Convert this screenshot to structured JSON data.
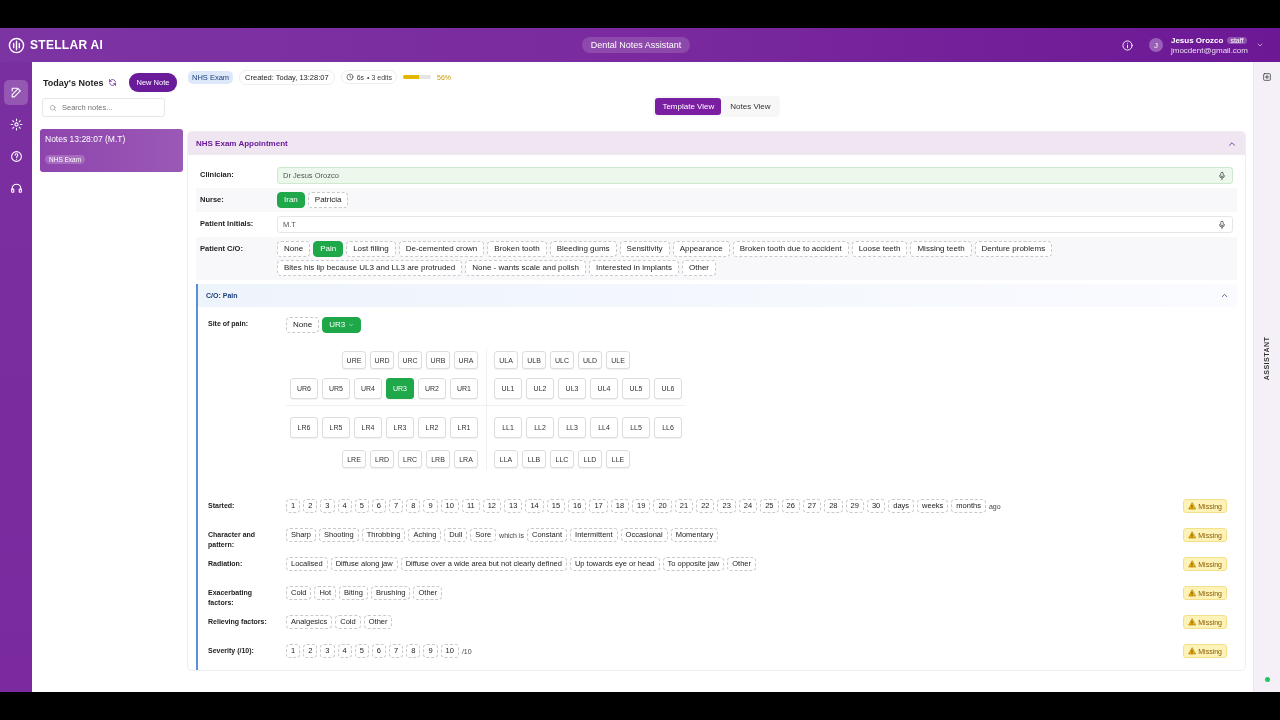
{
  "header": {
    "logo": "STELLAR AI",
    "app_title": "Dental Notes Assistant",
    "user": {
      "initial": "J",
      "name": "Jesus Orozco",
      "role": "staff",
      "email": "jmocdent@gmail.com"
    }
  },
  "rail": [
    {
      "selected": true
    },
    {
      "selected": false
    },
    {
      "selected": false
    },
    {
      "selected": false
    }
  ],
  "notes_panel": {
    "title": "Today's Notes",
    "new_button": "New Note",
    "search": {
      "placeholder": "Search notes..."
    },
    "notes": [
      {
        "title": "Notes 13:28:07 (M.T)",
        "tag": "NHS Exam",
        "selected": true
      }
    ]
  },
  "meta": {
    "template": "NHS Exam",
    "created": "Created: Today, 13:28:07",
    "timer": "6s",
    "edits": "• 3 edits",
    "progress": {
      "level": 0.56,
      "reading": "56%"
    }
  },
  "view_tabs": [
    {
      "label": "Template View",
      "selected": true
    },
    {
      "label": "Notes View",
      "selected": false
    }
  ],
  "section": {
    "title": "NHS Exam Appointment",
    "expanded": true,
    "fields": [
      {
        "kind": "text",
        "label": "Clinician:",
        "value": "Dr Jesus Orozco",
        "filled": true
      },
      {
        "kind": "chips",
        "label": "Nurse:",
        "options": [
          {
            "label": "Iran",
            "selected": true
          },
          {
            "label": "Patricia",
            "selected": false
          }
        ]
      },
      {
        "kind": "text",
        "label": "Patient Initials:",
        "value": "M.T",
        "filled": false
      },
      {
        "kind": "chips",
        "label": "Patient C/O:",
        "options": [
          {
            "label": "None",
            "selected": false
          },
          {
            "label": "Pain",
            "selected": true
          },
          {
            "label": "Lost filling",
            "selected": false
          },
          {
            "label": "De-cemented crown",
            "selected": false
          },
          {
            "label": "Broken tooth",
            "selected": false
          },
          {
            "label": "Bleeding gums",
            "selected": false
          },
          {
            "label": "Sensitivity",
            "selected": false
          },
          {
            "label": "Appearance",
            "selected": false
          },
          {
            "label": "Broken tooth due to accident",
            "selected": false
          },
          {
            "label": "Loose teeth",
            "selected": false
          },
          {
            "label": "Missing teeth",
            "selected": false
          },
          {
            "label": "Denture problems",
            "selected": false
          },
          {
            "label": "Bites his lip because UL3 and LL3 are protruded",
            "selected": false
          },
          {
            "label": "None - wants scale and polish",
            "selected": false
          },
          {
            "label": "Interested in implants",
            "selected": false
          },
          {
            "label": "Other",
            "selected": false
          }
        ]
      }
    ],
    "subsection": {
      "title": "C/O: Pain",
      "expanded": true,
      "site": {
        "label": "Site of pain:",
        "options": [
          {
            "label": "None",
            "selected": false
          },
          {
            "label": "UR3",
            "selected": true
          }
        ]
      },
      "teeth": [
        {
          "left": [
            {
              "label": "URE",
              "selected": false
            },
            {
              "label": "URD",
              "selected": false
            },
            {
              "label": "URC",
              "selected": false
            },
            {
              "label": "URB",
              "selected": false
            },
            {
              "label": "URA",
              "selected": false
            }
          ],
          "right": [
            {
              "label": "ULA",
              "selected": false
            },
            {
              "label": "ULB",
              "selected": false
            },
            {
              "label": "ULC",
              "selected": false
            },
            {
              "label": "ULD",
              "selected": false
            },
            {
              "label": "ULE",
              "selected": false
            }
          ]
        },
        {
          "left": [
            {
              "label": "UR6",
              "selected": false
            },
            {
              "label": "UR5",
              "selected": false
            },
            {
              "label": "UR4",
              "selected": false
            },
            {
              "label": "UR3",
              "selected": true
            },
            {
              "label": "UR2",
              "selected": false
            },
            {
              "label": "UR1",
              "selected": false
            }
          ],
          "right": [
            {
              "label": "UL1",
              "selected": false
            },
            {
              "label": "UL2",
              "selected": false
            },
            {
              "label": "UL3",
              "selected": false
            },
            {
              "label": "UL4",
              "selected": false
            },
            {
              "label": "UL5",
              "selected": false
            },
            {
              "label": "UL6",
              "selected": false
            }
          ]
        },
        {
          "left": [
            {
              "label": "LR6",
              "selected": false
            },
            {
              "label": "LR5",
              "selected": false
            },
            {
              "label": "LR4",
              "selected": false
            },
            {
              "label": "LR3",
              "selected": false
            },
            {
              "label": "LR2",
              "selected": false
            },
            {
              "label": "LR1",
              "selected": false
            }
          ],
          "right": [
            {
              "label": "LL1",
              "selected": false
            },
            {
              "label": "LL2",
              "selected": false
            },
            {
              "label": "LL3",
              "selected": false
            },
            {
              "label": "LL4",
              "selected": false
            },
            {
              "label": "LL5",
              "selected": false
            },
            {
              "label": "LL6",
              "selected": false
            }
          ]
        },
        {
          "left": [
            {
              "label": "LRE",
              "selected": false
            },
            {
              "label": "LRD",
              "selected": false
            },
            {
              "label": "LRC",
              "selected": false
            },
            {
              "label": "LRB",
              "selected": false
            },
            {
              "label": "LRA",
              "selected": false
            }
          ],
          "right": [
            {
              "label": "LLA",
              "selected": false
            },
            {
              "label": "LLB",
              "selected": false
            },
            {
              "label": "LLC",
              "selected": false
            },
            {
              "label": "LLD",
              "selected": false
            },
            {
              "label": "LLE",
              "selected": false
            }
          ]
        }
      ],
      "rows": [
        {
          "label": "Started:",
          "status": "Missing",
          "parts": [
            {
              "kind": "chips",
              "options": [
                {
                  "label": "1",
                  "selected": false
                },
                {
                  "label": "2",
                  "selected": false
                },
                {
                  "label": "3",
                  "selected": false
                },
                {
                  "label": "4",
                  "selected": false
                },
                {
                  "label": "5",
                  "selected": false
                },
                {
                  "label": "6",
                  "selected": false
                },
                {
                  "label": "7",
                  "selected": false
                },
                {
                  "label": "8",
                  "selected": false
                },
                {
                  "label": "9",
                  "selected": false
                },
                {
                  "label": "10",
                  "selected": false
                },
                {
                  "label": "11",
                  "selected": false
                },
                {
                  "label": "12",
                  "selected": false
                },
                {
                  "label": "13",
                  "selected": false
                },
                {
                  "label": "14",
                  "selected": false
                },
                {
                  "label": "15",
                  "selected": false
                },
                {
                  "label": "16",
                  "selected": false
                },
                {
                  "label": "17",
                  "selected": false
                },
                {
                  "label": "18",
                  "selected": false
                },
                {
                  "label": "19",
                  "selected": false
                },
                {
                  "label": "20",
                  "selected": false
                },
                {
                  "label": "21",
                  "selected": false
                },
                {
                  "label": "22",
                  "selected": false
                },
                {
                  "label": "23",
                  "selected": false
                },
                {
                  "label": "24",
                  "selected": false
                },
                {
                  "label": "25",
                  "selected": false
                },
                {
                  "label": "26",
                  "selected": false
                },
                {
                  "label": "27",
                  "selected": false
                },
                {
                  "label": "28",
                  "selected": false
                },
                {
                  "label": "29",
                  "selected": false
                },
                {
                  "label": "30",
                  "selected": false
                }
              ]
            },
            {
              "kind": "chips",
              "options": [
                {
                  "label": "days",
                  "selected": false
                },
                {
                  "label": "weeks",
                  "selected": false
                },
                {
                  "label": "months",
                  "selected": false
                }
              ]
            },
            {
              "kind": "text",
              "text": "ago"
            }
          ]
        },
        {
          "label": "Character and pattern:",
          "status": "Missing",
          "parts": [
            {
              "kind": "chips",
              "options": [
                {
                  "label": "Sharp",
                  "selected": false
                },
                {
                  "label": "Shooting",
                  "selected": false
                },
                {
                  "label": "Throbbing",
                  "selected": false
                },
                {
                  "label": "Aching",
                  "selected": false
                },
                {
                  "label": "Dull",
                  "selected": false
                },
                {
                  "label": "Sore",
                  "selected": false
                }
              ]
            },
            {
              "kind": "text",
              "text": "which is"
            },
            {
              "kind": "chips",
              "options": [
                {
                  "label": "Constant",
                  "selected": false
                },
                {
                  "label": "Intermittent",
                  "selected": false
                },
                {
                  "label": "Occasional",
                  "selected": false
                },
                {
                  "label": "Momentary",
                  "selected": false
                }
              ]
            }
          ]
        },
        {
          "label": "Radiation:",
          "status": "Missing",
          "parts": [
            {
              "kind": "chips",
              "options": [
                {
                  "label": "Localised",
                  "selected": false
                },
                {
                  "label": "Diffuse along jaw",
                  "selected": false
                },
                {
                  "label": "Diffuse over a wide area but not clearly defined",
                  "selected": false
                },
                {
                  "label": "Up towards eye or head",
                  "selected": false
                },
                {
                  "label": "To opposite jaw",
                  "selected": false
                },
                {
                  "label": "Other",
                  "selected": false
                }
              ]
            }
          ]
        },
        {
          "label": "Exacerbating factors:",
          "status": "Missing",
          "parts": [
            {
              "kind": "chips",
              "options": [
                {
                  "label": "Cold",
                  "selected": false
                },
                {
                  "label": "Hot",
                  "selected": false
                },
                {
                  "label": "Biting",
                  "selected": false
                },
                {
                  "label": "Brushing",
                  "selected": false
                },
                {
                  "label": "Other",
                  "selected": false
                }
              ]
            }
          ]
        },
        {
          "label": "Relieving factors:",
          "status": "Missing",
          "parts": [
            {
              "kind": "chips",
              "options": [
                {
                  "label": "Analgesics",
                  "selected": false
                },
                {
                  "label": "Cold",
                  "selected": false
                },
                {
                  "label": "Other",
                  "selected": false
                }
              ]
            }
          ]
        },
        {
          "label": "Severity (/10):",
          "status": "Missing",
          "parts": [
            {
              "kind": "chips",
              "options": [
                {
                  "label": "1",
                  "selected": false
                },
                {
                  "label": "2",
                  "selected": false
                },
                {
                  "label": "3",
                  "selected": false
                },
                {
                  "label": "4",
                  "selected": false
                },
                {
                  "label": "5",
                  "selected": false
                },
                {
                  "label": "6",
                  "selected": false
                },
                {
                  "label": "7",
                  "selected": false
                },
                {
                  "label": "8",
                  "selected": false
                },
                {
                  "label": "9",
                  "selected": false
                },
                {
                  "label": "10",
                  "selected": false
                }
              ]
            },
            {
              "kind": "text",
              "text": "/10"
            }
          ]
        }
      ]
    }
  },
  "assistant_tab": "ASSISTANT"
}
